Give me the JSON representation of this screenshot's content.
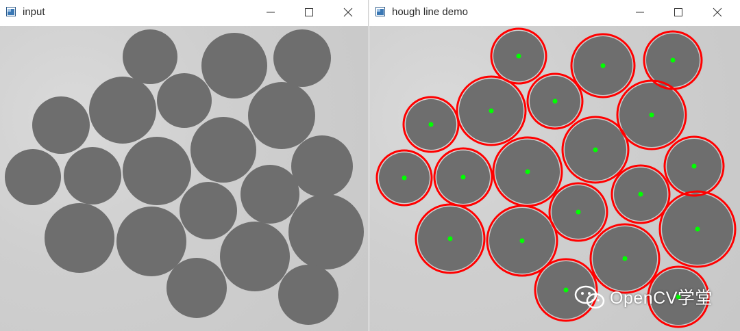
{
  "windows": [
    {
      "title": "input"
    },
    {
      "title": "hough line demo"
    }
  ],
  "controls": {
    "minimize_icon": "minimize-icon",
    "maximize_icon": "maximize-icon",
    "close_icon": "close-icon"
  },
  "watermark": {
    "text": "OpenCV学堂",
    "icon": "wechat-icon"
  },
  "colors": {
    "disc": "#6e6e6e",
    "background": "#cccccc",
    "circle_outline": "#ff0000",
    "center_dot": "#00ff00"
  },
  "detected_circle_count": 21
}
